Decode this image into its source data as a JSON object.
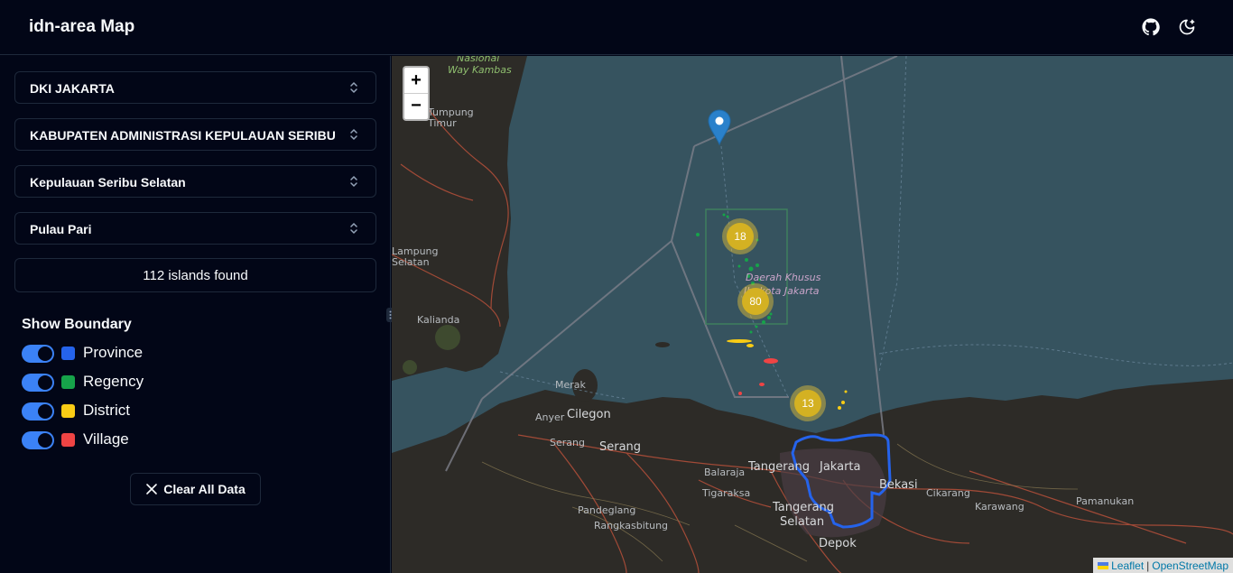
{
  "header": {
    "title": "idn-area Map",
    "github_icon": "github-icon",
    "theme_icon": "moon-star-icon"
  },
  "sidebar": {
    "selects": [
      {
        "name": "province-select",
        "value": "DKI JAKARTA"
      },
      {
        "name": "regency-select",
        "value": "KABUPATEN ADMINISTRASI KEPULAUAN SERIBU"
      },
      {
        "name": "district-select",
        "value": "Kepulauan Seribu Selatan"
      },
      {
        "name": "village-select",
        "value": "Pulau Pari"
      }
    ],
    "islands_found": "112 islands found",
    "boundary": {
      "title": "Show Boundary",
      "items": [
        {
          "label": "Province",
          "color": "#2563eb",
          "enabled": true
        },
        {
          "label": "Regency",
          "color": "#16a34a",
          "enabled": true
        },
        {
          "label": "District",
          "color": "#facc15",
          "enabled": true
        },
        {
          "label": "Village",
          "color": "#ef4444",
          "enabled": true
        }
      ]
    },
    "clear_button": "Clear All Data"
  },
  "map": {
    "zoom_in": "+",
    "zoom_out": "−",
    "clusters": [
      "18",
      "80",
      "13"
    ],
    "place_labels": [
      "Nasional",
      "Way Kambas",
      "Tumpung",
      "Timur",
      "Lampung",
      "Selatan",
      "Kalianda",
      "Daerah Khusus",
      "Ibukota Jakarta",
      "Merak",
      "Cilegon",
      "Anyer",
      "Serang",
      "Serang",
      "Tangerang",
      "Jakarta",
      "Balaraja",
      "Bekasi",
      "Cikarang",
      "Tigaraksa",
      "Tangerang",
      "Selatan",
      "Pandeglang",
      "Rangkasbitung",
      "Depok",
      "Karawang",
      "Pamanukan"
    ],
    "attribution": {
      "leaflet": "Leaflet",
      "separator": "|",
      "osm": "OpenStreetMap"
    }
  }
}
